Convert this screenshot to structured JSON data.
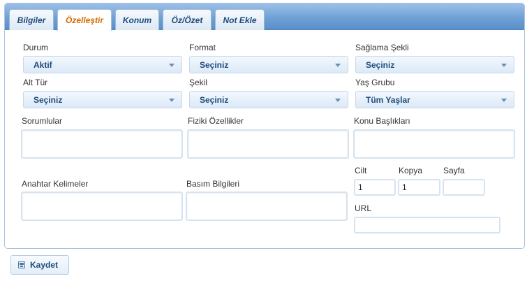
{
  "tabs": [
    {
      "label": "Bilgiler",
      "active": false
    },
    {
      "label": "Özelleştir",
      "active": true
    },
    {
      "label": "Konum",
      "active": false
    },
    {
      "label": "Öz/Özet",
      "active": false
    },
    {
      "label": "Not Ekle",
      "active": false
    }
  ],
  "fields": {
    "durum": {
      "label": "Durum",
      "value": "Aktif"
    },
    "format": {
      "label": "Format",
      "value": "Seçiniz"
    },
    "saglama_sekli": {
      "label": "Sağlama Şekli",
      "value": "Seçiniz"
    },
    "alt_tur": {
      "label": "Alt Tür",
      "value": "Seçiniz"
    },
    "sekil": {
      "label": "Şekil",
      "value": "Seçiniz"
    },
    "yas_grubu": {
      "label": "Yaş Grubu",
      "value": "Tüm Yaşlar"
    },
    "sorumlular": {
      "label": "Sorumlular",
      "value": ""
    },
    "fiziki_ozellikler": {
      "label": "Fiziki Özellikler",
      "value": ""
    },
    "konu_basliklari": {
      "label": "Konu Başlıkları",
      "value": ""
    },
    "anahtar_kelimeler": {
      "label": "Anahtar Kelimeler",
      "value": ""
    },
    "basim_bilgileri": {
      "label": "Basım Bilgileri",
      "value": ""
    },
    "cilt": {
      "label": "Cilt",
      "value": "1"
    },
    "kopya": {
      "label": "Kopya",
      "value": "1"
    },
    "sayfa": {
      "label": "Sayfa",
      "value": ""
    },
    "url": {
      "label": "URL",
      "value": ""
    }
  },
  "actions": {
    "save_label": "Kaydet"
  },
  "icons": {
    "save": "floppy-disk-icon",
    "dropdown": "chevron-down-icon"
  },
  "colors": {
    "tab_bar": "#6fa1d6",
    "active_tab_text": "#d46a00",
    "text_blue": "#1d4b7c",
    "border": "#a9c3df"
  }
}
